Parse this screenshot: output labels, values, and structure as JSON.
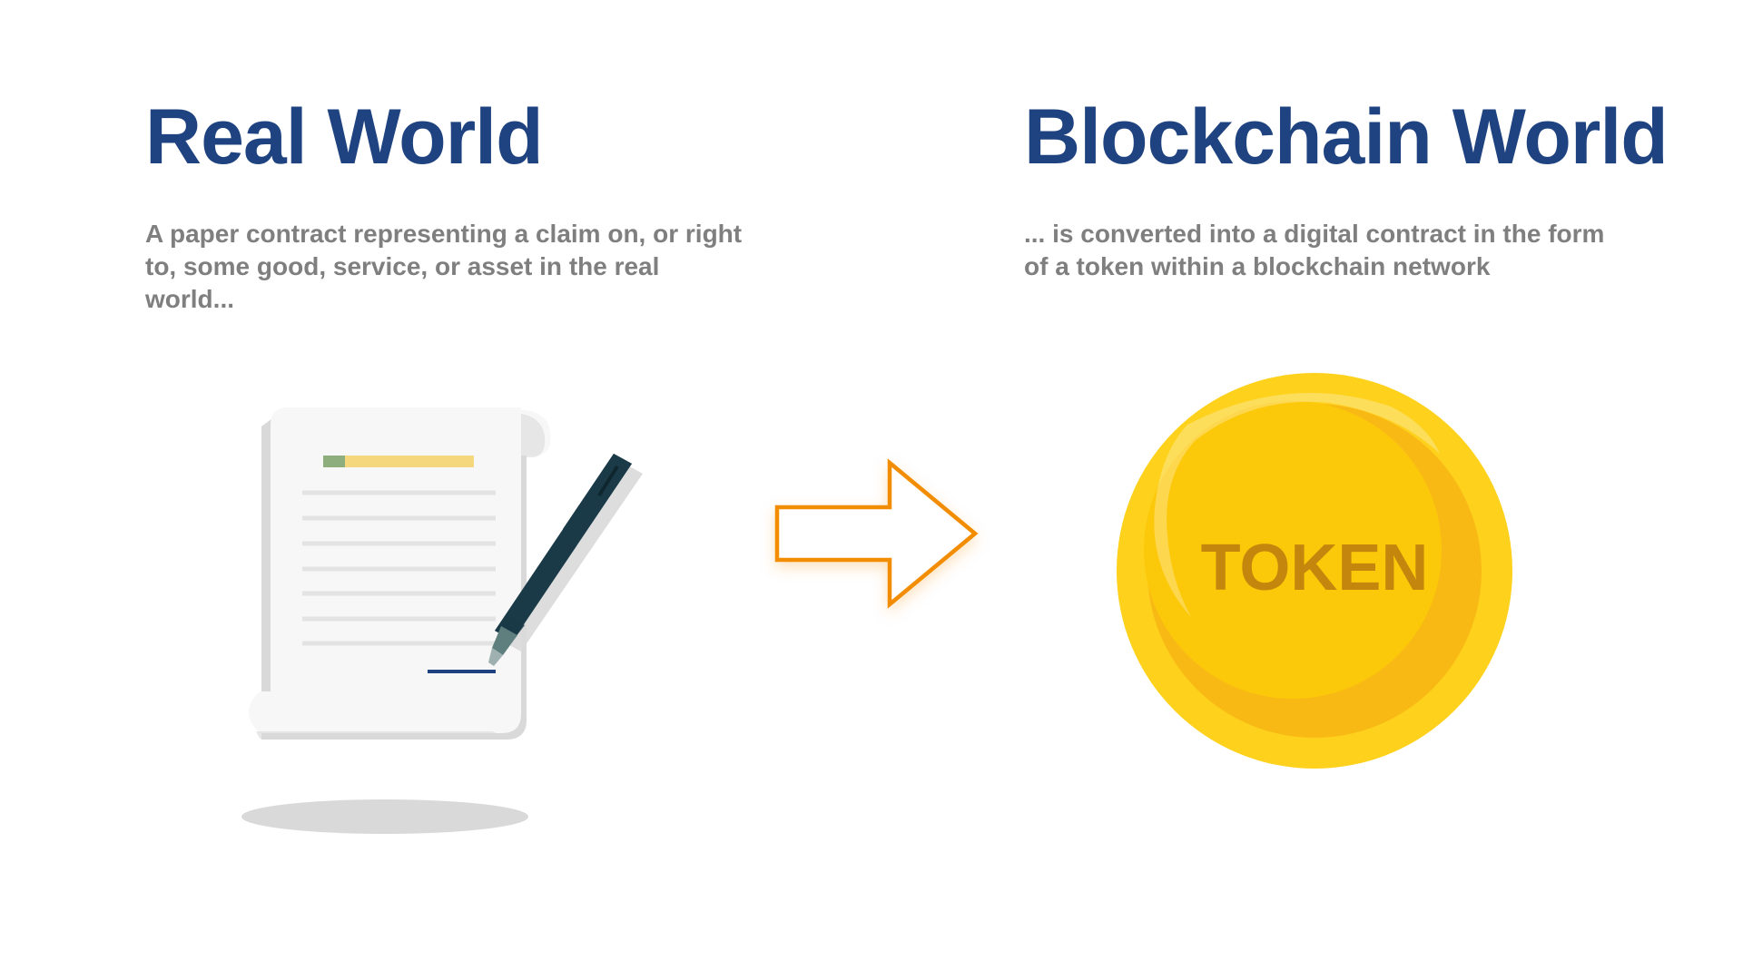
{
  "colors": {
    "heading": "#1f4380",
    "description": "#7f7f7f",
    "arrow": "#f28c00",
    "coin_outer": "#fdd11c",
    "coin_inner": "#fcc80a",
    "coin_shade": "#f9b915",
    "token_text": "#c4860c",
    "paper": "#f7f7f7",
    "paper_shade": "#d9d9d9",
    "pen": "#1a3a47",
    "signature": "#1f4380",
    "doc_title_bar": "#f5d77d",
    "doc_title_tab": "#8fae7e",
    "doc_lines": "#e3e3e3"
  },
  "real_world": {
    "title": "Real World",
    "description": "A paper contract representing a claim on, or right to, some good, service, or asset in the real world..."
  },
  "blockchain_world": {
    "title": "Blockchain World",
    "description": "... is converted into a digital contract in the form of a token within a blockchain network"
  },
  "token": {
    "label": "TOKEN"
  },
  "icons": {
    "contract": "signed-contract-scroll-icon",
    "pen": "pen-icon",
    "arrow": "right-arrow-icon",
    "coin": "token-coin-icon"
  }
}
